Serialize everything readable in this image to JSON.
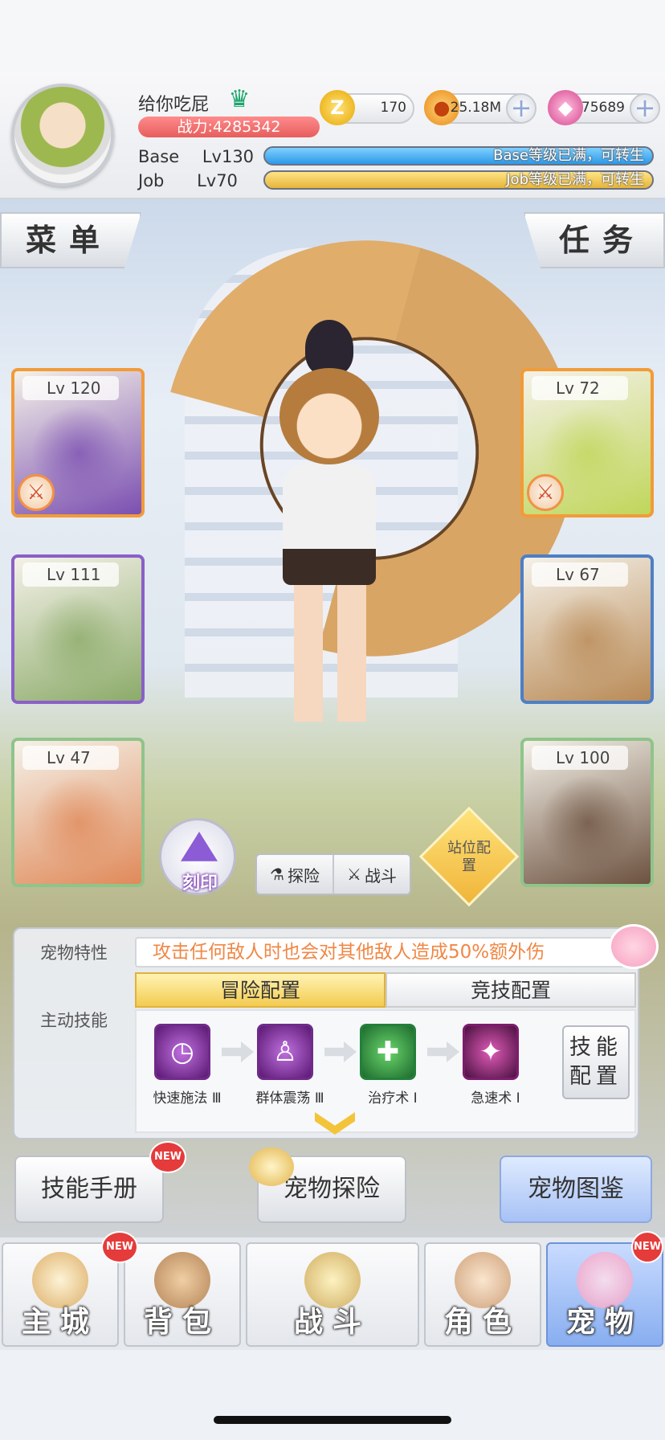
{
  "player": {
    "name": "给你吃屁",
    "power": "战力:4285342",
    "base_label": "Base",
    "base_level": "Lv130",
    "base_status": "Base等级已满，可转生",
    "job_label": "Job",
    "job_level": "Lv70",
    "job_status": "Job等级已满，可转生"
  },
  "currencies": [
    {
      "icon": "zeny-coin-icon",
      "symbol": "Z",
      "value": "170",
      "color": "#f3b300"
    },
    {
      "icon": "gold-pouch-icon",
      "symbol": "●",
      "value": "25.18M",
      "color": "#f0a020"
    },
    {
      "icon": "crystal-icon",
      "symbol": "◆",
      "value": "75689",
      "color": "#e44c9a"
    }
  ],
  "buttons": {
    "menu": "菜单",
    "task": "任务",
    "engrave": "刻印",
    "explore": "探险",
    "battle": "战斗",
    "station": "站位配置"
  },
  "pets_left": [
    {
      "level": "Lv 120",
      "has_weapon": true,
      "color": "#7b4fb1",
      "border": "#f29b38"
    },
    {
      "level": "Lv 111",
      "has_weapon": false,
      "color": "#8cab6a",
      "border": "#8a5fc9"
    },
    {
      "level": "Lv 47",
      "has_weapon": false,
      "color": "#e08a5a",
      "border": "#8fc48a"
    }
  ],
  "pets_right": [
    {
      "level": "Lv 72",
      "has_weapon": true,
      "color": "#c0d65a",
      "border": "#f29b38"
    },
    {
      "level": "Lv 67",
      "has_weapon": false,
      "color": "#b98a56",
      "border": "#4d7fc5"
    },
    {
      "level": "Lv 100",
      "has_weapon": false,
      "color": "#6d5240",
      "border": "#8fc48a"
    }
  ],
  "panel": {
    "trait_label": "宠物特性",
    "trait_text": "攻击任何敌人时也会对其他敌人造成50%额外伤",
    "skill_label": "主动技能",
    "tab_adventure": "冒险配置",
    "tab_arena": "竞技配置",
    "skill_config": "技能配置",
    "skills": [
      {
        "name": "快速施法 Ⅲ",
        "icon": "clock-icon",
        "glyph": "◷"
      },
      {
        "name": "群体震荡 Ⅲ",
        "icon": "group-shock-icon",
        "glyph": "♙"
      },
      {
        "name": "治疗术 Ⅰ",
        "icon": "heal-icon",
        "glyph": "✚"
      },
      {
        "name": "急速术 Ⅰ",
        "icon": "haste-icon",
        "glyph": "✦"
      }
    ]
  },
  "actions": {
    "skill_manual": "技能手册",
    "pet_explore": "宠物探险",
    "pet_atlas": "宠物图鉴",
    "new_badge": "NEW"
  },
  "nav": [
    {
      "label": "主城",
      "new": true
    },
    {
      "label": "背包",
      "new": false
    },
    {
      "label": "战斗",
      "new": false
    },
    {
      "label": "角色",
      "new": false
    },
    {
      "label": "宠物",
      "new": true
    }
  ]
}
